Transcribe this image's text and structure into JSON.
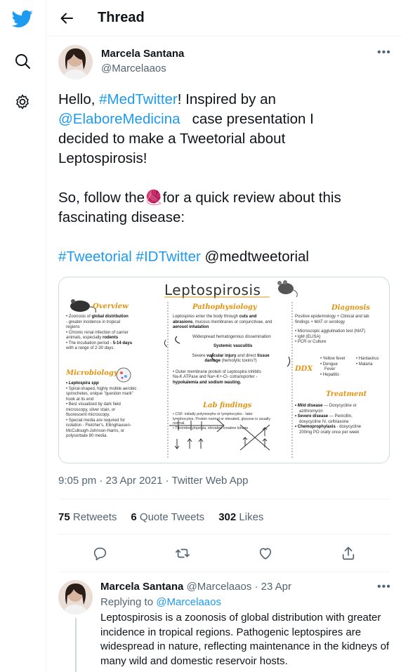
{
  "nav": {
    "icons": [
      "twitter-logo-icon",
      "search-icon",
      "settings-icon"
    ]
  },
  "header": {
    "title": "Thread"
  },
  "tweet": {
    "author": "Marcela Santana",
    "handle": "@Marcelaaos",
    "text": {
      "l1_pre": "Hello, ",
      "l1_tag": "#MedTwitter",
      "l1_post": "! Inspired by an",
      "l2_mention": "@ElaboreMedicina",
      "l2_post": "   case presentation I",
      "l3": "decided to make a Tweetorial about",
      "l4": "Leptospirosis!",
      "l5_pre": "So, follow the",
      "l5_emoji": "🧶",
      "l5_post": "for a quick review about this",
      "l6": "fascinating disease:",
      "tag1": "#Tweetorial",
      "tag2": "#IDTwitter",
      "mention2": "@medtweetorial"
    },
    "timestamp": "9:05 pm · 23 Apr 2021 · Twitter Web App",
    "stats": {
      "retweets_count": "75",
      "retweets_label": "Retweets",
      "quotes_count": "6",
      "quotes_label": "Quote Tweets",
      "likes_count": "302",
      "likes_label": "Likes"
    }
  },
  "infographic": {
    "title": "Leptospirosis",
    "overview": {
      "heading": "Overview",
      "l1a": "• Zoonosis of ",
      "l1b": "global distribution",
      "l2": "- greater incidence in tropical",
      "l3": "regions",
      "l4": "• Chronic renal infection of carrier",
      "l5a": "animals, especially ",
      "l5b": "rodents",
      "l6a": "• The incubation period - ",
      "l6b": "5-14 days",
      "l7": "with a range of 2-30 days."
    },
    "micro": {
      "heading": "Microbiology",
      "l1": "• Leptospira spp",
      "l2": "• Spiral-shaped, highly mobile aerobic",
      "l3": "spirochetes, unique \"question mark\"",
      "l4": "hook at its end",
      "l5": "• Best visualized by dark field",
      "l6": "microscopy, silver stain, or",
      "l7": "fluorescent microscopy.",
      "l8": "• Special media are required for",
      "l9": "isolation - Fletcher's, Ellinghausen-",
      "l10": "McCullough-Johnson-Harris, or",
      "l11": "polysorbate 80 media."
    },
    "patho": {
      "heading": "Pathophysiology",
      "l1a": "Leptospires enter the body through ",
      "l1b": "cuts and",
      "l2a": "abrasions",
      "l2b": ", mucous membranes or conjunctivae, and",
      "l3": "aerosol inhalation",
      "l4": "Widespread hematogenous dissemination",
      "l5": "Systemic vasculitis",
      "l6a": "Severe ",
      "l6b": "vascular injury",
      "l6c": " and direct ",
      "l6d": "tissue",
      "l7a": "damage",
      "l7b": " (hemolytic toxins?)",
      "l8": "• Outer membrane protein of Leptospira inhibits",
      "l9": "Na-K ATPase and Na+-K+-Cl- cotransporter -",
      "l10": "hypokalemia and sodium wasting."
    },
    "lab": {
      "heading": "Lab findings",
      "l1": "• CSF: initially polymorphs or lymphocytes - later",
      "l2": "lymphocytes. Protein normal or elevated, glucose is usually",
      "l3": "normal.",
      "l4": "• Thrombocytopenia, elevated creatine kinase"
    },
    "diagnosis": {
      "heading": "Diagnosis",
      "l1": "Positive epidemiology + Clinical and lab",
      "l2": "findings + MAT or serology",
      "l3": "• Microscopic agglutination test (MAT)",
      "l4": "• IgM (ELISA)",
      "l5": "• PCR or Culture"
    },
    "ddx": {
      "heading": "DDX",
      "c1": [
        "• Yellow fever",
        "• Dengue",
        "Fever",
        "• Hepatitis"
      ],
      "c2": [
        "• Hantavirus",
        "• Malaria"
      ]
    },
    "treatment": {
      "heading": "Treatment",
      "l1a": "• Mild disease",
      "l1b": " — Doxycycline or",
      "l2": "azithromycin",
      "l3a": "• Severe disease",
      "l3b": " — Penicillin,",
      "l4": "doxycycline IV, ceftriaxone",
      "l5a": "• Chemoprophylaxis",
      "l5b": " - doxycycline",
      "l6": "200mg PO orally once per week"
    }
  },
  "reply": {
    "author": "Marcela Santana",
    "handle_date": "@Marcelaaos · 23 Apr",
    "replying_prefix": "Replying to ",
    "replying_to": "@Marcelaaos",
    "text": "Leptospirosis is a zoonosis of global distribution with greater incidence in tropical regions. Pathogenic leptospires are widespread in nature, reflecting maintenance in the kidneys of many wild and domestic reservoir hosts."
  },
  "colors": {
    "accent": "#1d9bf0",
    "heading_orange": "#e09414",
    "secondary_text": "#536471"
  }
}
